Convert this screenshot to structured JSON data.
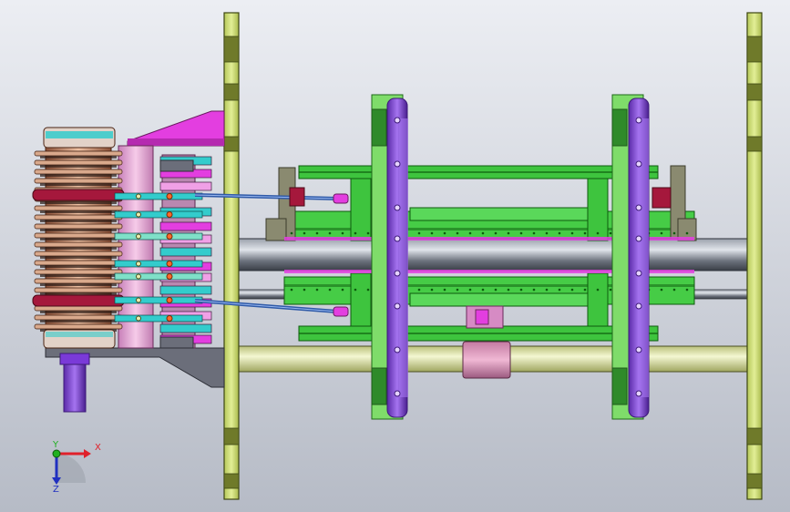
{
  "viewport": {
    "background_top": "#eceef3",
    "background_bottom": "#b6bbc6"
  },
  "colors": {
    "frame_plate": "#ccdd77",
    "frame_plate_dark": "#5e6a22",
    "shaft_gray": "#5f6570",
    "shaft_light": "#c8cdd6",
    "rod_yellow": "#e8eeb0",
    "green_part": "#3ec43e",
    "green_dark": "#0d5a0d",
    "purple_disc": "#8a44e6",
    "purple_dark": "#3d1a78",
    "lime_bracket": "#7fdc6a",
    "magenta_part": "#e33ee0",
    "pink_part": "#e6a3d6",
    "salmon_coil": "#c97f5e",
    "cyan_part": "#33cccc",
    "red_ring": "#a5183c",
    "blue_rod": "#2f5aa8",
    "olive_gray": "#8a8a70",
    "orange_bolt": "#ff6a2a"
  },
  "triad": {
    "x_label": "X",
    "y_label": "Y",
    "z_label": "Z",
    "x_color": "#e0202a",
    "y_color": "#20b020",
    "z_color": "#2030c0"
  }
}
